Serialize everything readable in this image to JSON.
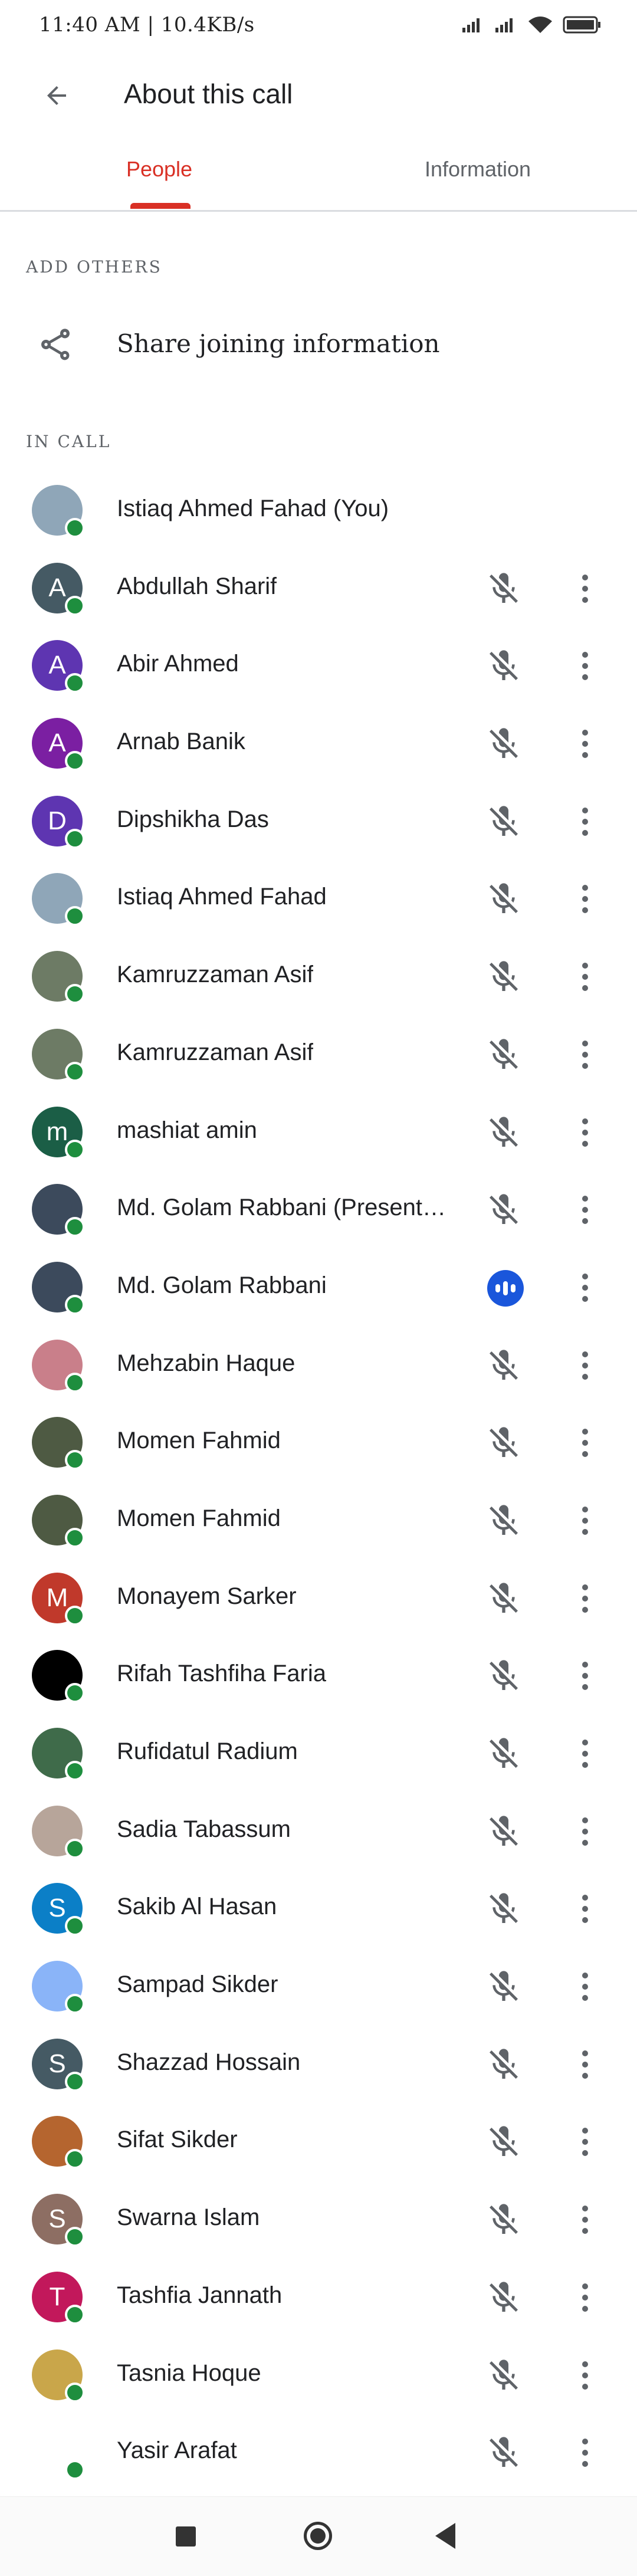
{
  "status_bar": {
    "time_text": "11:40 AM | 10.4KB/s"
  },
  "header": {
    "title": "About this call"
  },
  "tabs": [
    {
      "label": "People"
    },
    {
      "label": "Information"
    }
  ],
  "sections": {
    "add_others": "ADD OTHERS",
    "share_label": "Share joining information",
    "in_call": "IN CALL"
  },
  "colors": {
    "accent": "#d93025",
    "presence": "#1e8e3e",
    "speaking": "#1a56db"
  },
  "participants": [
    {
      "name": "Istiaq Ahmed Fahad (You)",
      "initial": "",
      "avatar_color": "#8fa6b8",
      "mic": "none"
    },
    {
      "name": "Abdullah Sharif",
      "initial": "A",
      "avatar_color": "#455a64",
      "mic": "muted"
    },
    {
      "name": "Abir Ahmed",
      "initial": "A",
      "avatar_color": "#5e35b1",
      "mic": "muted"
    },
    {
      "name": "Arnab Banik",
      "initial": "A",
      "avatar_color": "#7b1fa2",
      "mic": "muted"
    },
    {
      "name": "Dipshikha Das",
      "initial": "D",
      "avatar_color": "#5e35b1",
      "mic": "muted"
    },
    {
      "name": "Istiaq Ahmed Fahad",
      "initial": "",
      "avatar_color": "#8fa6b8",
      "mic": "muted"
    },
    {
      "name": "Kamruzzaman Asif",
      "initial": "",
      "avatar_color": "#6d7b65",
      "mic": "muted"
    },
    {
      "name": "Kamruzzaman Asif",
      "initial": "",
      "avatar_color": "#6d7b65",
      "mic": "muted"
    },
    {
      "name": "mashiat amin",
      "initial": "m",
      "avatar_color": "#1b5e46",
      "mic": "muted"
    },
    {
      "name": "Md. Golam Rabbani (Presentation)",
      "initial": "",
      "avatar_color": "#3c4a5c",
      "mic": "muted"
    },
    {
      "name": "Md. Golam Rabbani",
      "initial": "",
      "avatar_color": "#3c4a5c",
      "mic": "speaking"
    },
    {
      "name": "Mehzabin Haque",
      "initial": "",
      "avatar_color": "#c97f8a",
      "mic": "muted"
    },
    {
      "name": "Momen Fahmid",
      "initial": "",
      "avatar_color": "#4e5a43",
      "mic": "muted"
    },
    {
      "name": "Momen Fahmid",
      "initial": "",
      "avatar_color": "#4e5a43",
      "mic": "muted"
    },
    {
      "name": "Monayem Sarker",
      "initial": "M",
      "avatar_color": "#c0392b",
      "mic": "muted"
    },
    {
      "name": "Rifah Tashfiha Faria",
      "initial": "",
      "avatar_color": "#000000",
      "mic": "muted"
    },
    {
      "name": "Rufidatul Radium",
      "initial": "",
      "avatar_color": "#3f6b4a",
      "mic": "muted"
    },
    {
      "name": "Sadia Tabassum",
      "initial": "",
      "avatar_color": "#b7a59a",
      "mic": "muted"
    },
    {
      "name": "Sakib Al Hasan",
      "initial": "S",
      "avatar_color": "#0b7fc7",
      "mic": "muted"
    },
    {
      "name": "Sampad Sikder",
      "initial": "",
      "avatar_color": "#8ab4f8",
      "mic": "muted"
    },
    {
      "name": "Shazzad Hossain",
      "initial": "S",
      "avatar_color": "#455a64",
      "mic": "muted"
    },
    {
      "name": "Sifat Sikder",
      "initial": "",
      "avatar_color": "#b5652f",
      "mic": "muted"
    },
    {
      "name": "Swarna Islam",
      "initial": "S",
      "avatar_color": "#8d6e63",
      "mic": "muted"
    },
    {
      "name": "Tashfia Jannath",
      "initial": "T",
      "avatar_color": "#c2185b",
      "mic": "muted"
    },
    {
      "name": "Tasnia Hoque",
      "initial": "",
      "avatar_color": "#c9a64a",
      "mic": "muted"
    },
    {
      "name": "Yasir Arafat",
      "initial": "",
      "avatar_color": "#ffffff",
      "mic": "muted"
    }
  ]
}
